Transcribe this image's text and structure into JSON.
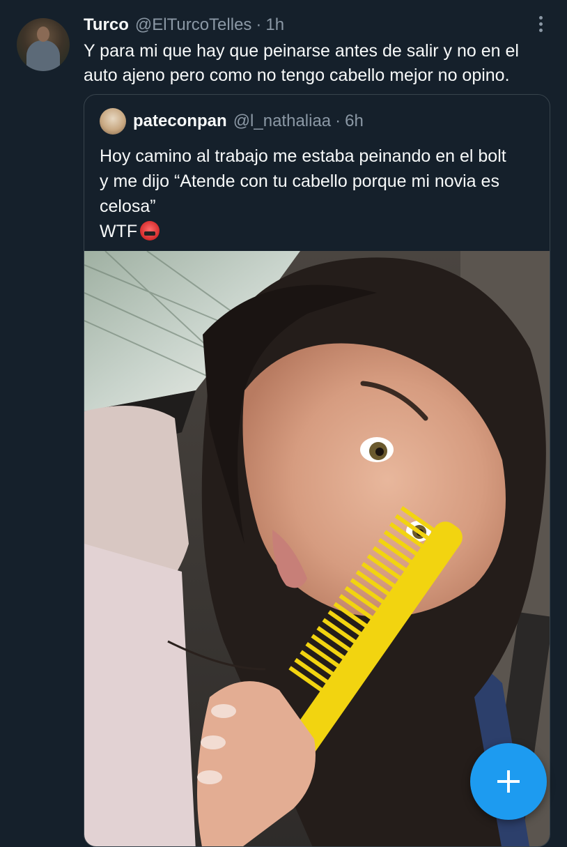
{
  "tweet": {
    "display_name": "Turco",
    "handle": "@ElTurcoTelles",
    "separator": "·",
    "time": "1h",
    "text": "Y para mi que hay que peinarse antes de salir y no en el auto ajeno pero como no tengo cabello mejor no opino."
  },
  "quoted_tweet": {
    "display_name": "pateconpan",
    "handle": "@l_nathaliaa",
    "separator": "·",
    "time": "6h",
    "text_lines": [
      "Hoy camino al trabajo me estaba peinando en el bolt",
      "y me dijo “Atende con tu cabello porque mi novia es",
      "celosa”",
      "WTF"
    ],
    "emoji": "face-with-symbols-on-mouth"
  },
  "icons": {
    "more": "more-vertical-icon",
    "compose": "plus-icon"
  },
  "colors": {
    "background": "#15202b",
    "text_primary": "#f7f9f9",
    "text_secondary": "#8b98a5",
    "border": "#38444d",
    "accent": "#1d9bf0",
    "comb": "#f2d410"
  }
}
